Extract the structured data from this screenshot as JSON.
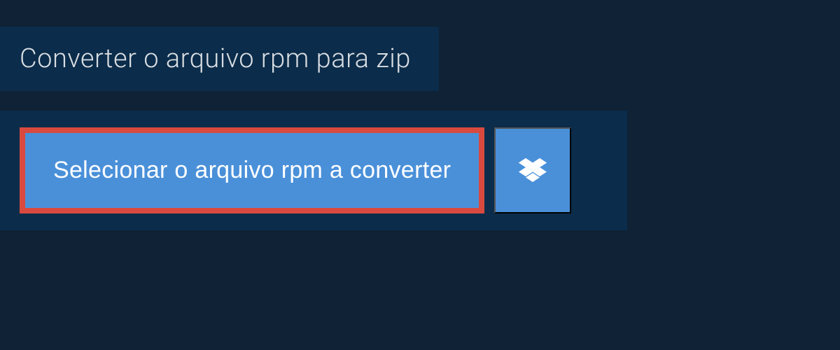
{
  "header": {
    "title": "Converter o arquivo rpm para zip"
  },
  "actions": {
    "select_label": "Selecionar o arquivo rpm a converter"
  }
}
